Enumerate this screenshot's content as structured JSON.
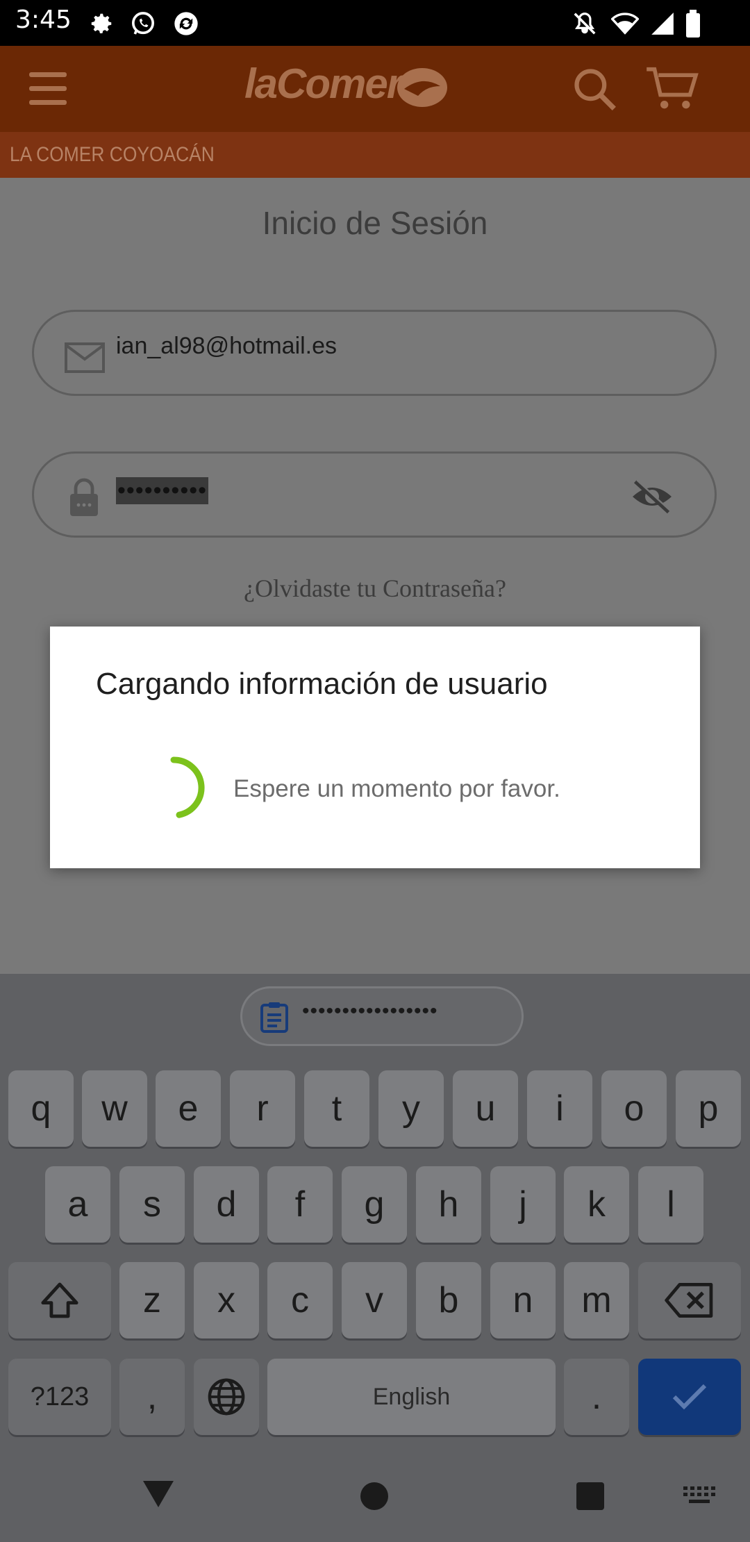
{
  "status_bar": {
    "time": "3:45"
  },
  "header": {
    "logo": "laComer",
    "store_name": "LA COMER COYOACÁN"
  },
  "login": {
    "title": "Inicio de Sesión",
    "email_value": "ian_al98@hotmail.es",
    "password_value": "••••••••••",
    "forgot_password": "¿Olvidaste tu Contraseña?"
  },
  "dialog": {
    "title": "Cargando información de usuario",
    "message": "Espere un momento por favor.",
    "spinner_color": "#7cc21c"
  },
  "keyboard": {
    "clipboard_text": "•••••••••••••••••",
    "row1": [
      "q",
      "w",
      "e",
      "r",
      "t",
      "y",
      "u",
      "i",
      "o",
      "p"
    ],
    "row2": [
      "a",
      "s",
      "d",
      "f",
      "g",
      "h",
      "j",
      "k",
      "l"
    ],
    "row3": [
      "z",
      "x",
      "c",
      "v",
      "b",
      "n",
      "m"
    ],
    "symbols_key": "?123",
    "comma_key": ",",
    "space_label": "English",
    "period_key": ".",
    "icons": [
      "shift-icon",
      "backspace-icon",
      "globe-icon",
      "checkmark-icon"
    ]
  },
  "colors": {
    "header_bg": "#6b2805",
    "store_bar_bg": "#7e3312",
    "accent_action": "#11387a"
  }
}
